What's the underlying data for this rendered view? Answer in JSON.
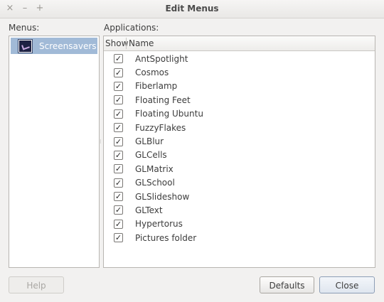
{
  "window": {
    "title": "Edit Menus",
    "controls": {
      "close": "×",
      "minimize": "–",
      "maximize": "+"
    }
  },
  "menus": {
    "label": "Menus:",
    "items": [
      {
        "label": "Screensavers",
        "icon": "screensaver-icon",
        "selected": true
      }
    ]
  },
  "applications": {
    "label": "Applications:",
    "columns": {
      "show": "Show",
      "name": "Name"
    },
    "checkmark": "✓",
    "rows": [
      {
        "name": "AntSpotlight",
        "show": true
      },
      {
        "name": "Cosmos",
        "show": true
      },
      {
        "name": "Fiberlamp",
        "show": true
      },
      {
        "name": "Floating Feet",
        "show": true
      },
      {
        "name": "Floating Ubuntu",
        "show": true
      },
      {
        "name": "FuzzyFlakes",
        "show": true
      },
      {
        "name": "GLBlur",
        "show": true
      },
      {
        "name": "GLCells",
        "show": true
      },
      {
        "name": "GLMatrix",
        "show": true
      },
      {
        "name": "GLSchool",
        "show": true
      },
      {
        "name": "GLSlideshow",
        "show": true
      },
      {
        "name": "GLText",
        "show": true
      },
      {
        "name": "Hypertorus",
        "show": true
      },
      {
        "name": "Pictures folder",
        "show": true
      }
    ]
  },
  "buttons": {
    "help": "Help",
    "defaults": "Defaults",
    "close": "Close"
  },
  "colors": {
    "selection": "#a1bad7",
    "window_bg": "#f2f1f0"
  }
}
